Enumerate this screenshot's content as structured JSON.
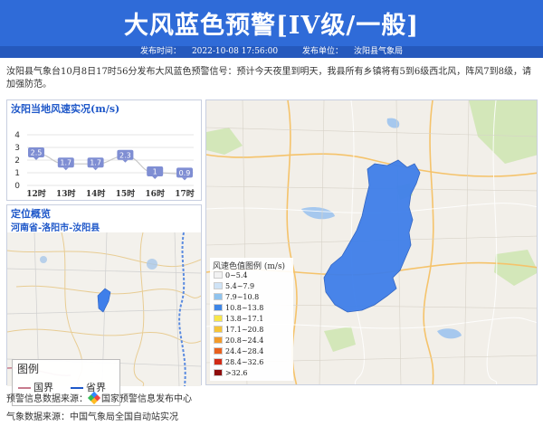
{
  "header": {
    "title": "大风蓝色预警[IV级/一般]",
    "release_time_label": "发布时间：",
    "release_time": "2022-10-08 17:56:00",
    "unit_label": "发布单位：",
    "unit": "汝阳县气象局"
  },
  "description": "汝阳县气象台10月8日17时56分发布大风蓝色预警信号：预计今天夜里到明天，我县所有乡镇将有5到6级西北风，阵风7到8级，请加强防范。",
  "wind_panel": {
    "title": "汝阳当地风速实况(m/s)"
  },
  "chart_data": {
    "type": "line",
    "categories": [
      "12时",
      "13时",
      "14时",
      "15时",
      "16时",
      "17时"
    ],
    "values": [
      2.5,
      1.7,
      1.7,
      2.3,
      1,
      0.9
    ],
    "value_labels": [
      "2.5",
      "1.7",
      "1.7",
      "2.3",
      "1",
      "0.9"
    ],
    "yticks": [
      0,
      1,
      2,
      3,
      4
    ],
    "ylim": [
      0,
      4
    ],
    "grid": true,
    "line_color": "#c7c7c7",
    "label_color": "#7f8ed3"
  },
  "location_panel": {
    "title": "定位概览",
    "subtitle": "河南省-洛阳市-汝阳县",
    "legend_title": "图例",
    "legend_items": [
      {
        "label": "国界",
        "color": "#c77b8d"
      },
      {
        "label": "省界",
        "color": "#1f58c9"
      }
    ]
  },
  "main_map": {
    "scale_title": "风速色值图例 (m/s)",
    "scale": [
      {
        "label": "0~5.4",
        "color": "#f2f2f2"
      },
      {
        "label": "5.4~7.9",
        "color": "#cfe3f6"
      },
      {
        "label": "7.9~10.8",
        "color": "#8fc3ee"
      },
      {
        "label": "10.8~13.8",
        "color": "#3f86e6"
      },
      {
        "label": "13.8~17.1",
        "color": "#f7e64a"
      },
      {
        "label": "17.1~20.8",
        "color": "#f5c53a"
      },
      {
        "label": "20.8~24.4",
        "color": "#f29b2b"
      },
      {
        "label": "24.4~28.4",
        "color": "#e8611f"
      },
      {
        "label": "28.4~32.6",
        "color": "#d12b17"
      },
      {
        "label": ">32.6",
        "color": "#8e0c0c"
      }
    ],
    "warning_area_color": "#3f7fea"
  },
  "footer": {
    "source_label": "预警信息数据来源：",
    "source": "国家预警信息发布中心",
    "weather_label": "气象数据来源：",
    "weather_source": "中国气象局全国自动站实况"
  }
}
